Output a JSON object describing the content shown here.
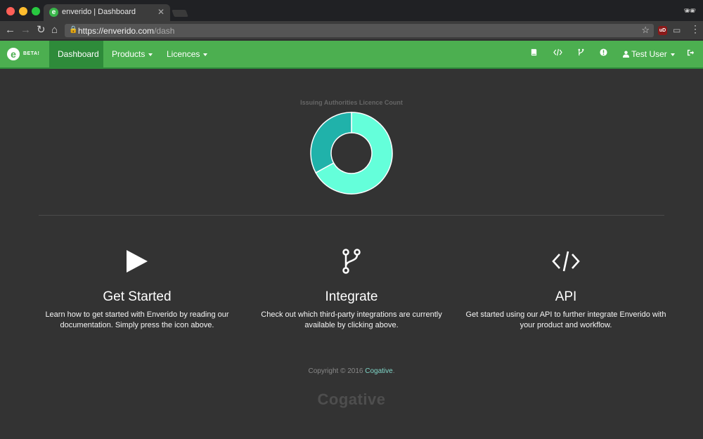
{
  "browser": {
    "tab_title": "enverido | Dashboard",
    "tab_favicon_letter": "e",
    "url_base": "https://enverido.com",
    "url_path": "/dash",
    "ublock_label": "uD"
  },
  "navbar": {
    "brand_letter": "e",
    "brand_badge": "BETA!",
    "items": [
      {
        "label": "Dashboard",
        "active": true
      },
      {
        "label": "Products",
        "dropdown": true
      },
      {
        "label": "Licences",
        "dropdown": true
      }
    ],
    "right_icons": [
      "book-icon",
      "code-icon",
      "git-branch-icon",
      "info-icon",
      "sign-out-icon"
    ],
    "user_label": "Test User"
  },
  "chart": {
    "title": "Issuing Authorities Licence Count",
    "colors": [
      "#64ffda",
      "#20b2aa"
    ]
  },
  "chart_data": {
    "type": "pie",
    "title": "Issuing Authorities Licence Count",
    "values": [
      67,
      33
    ],
    "colors": [
      "#64ffda",
      "#20b2aa"
    ],
    "donut": true
  },
  "features": [
    {
      "icon": "play-icon",
      "title": "Get Started",
      "description": "Learn how to get started with Enverido by reading our documentation. Simply press the icon above."
    },
    {
      "icon": "git-branch-icon",
      "title": "Integrate",
      "description": "Check out which third-party integrations are currently available by clicking above."
    },
    {
      "icon": "code-icon",
      "title": "API",
      "description": "Get started using our API to further integrate Enverido with your product and workflow."
    }
  ],
  "footer": {
    "copyright_prefix": "Copyright © 2016 ",
    "company": "Cogative",
    "copyright_suffix": ".",
    "logo_text": "Cogative"
  }
}
